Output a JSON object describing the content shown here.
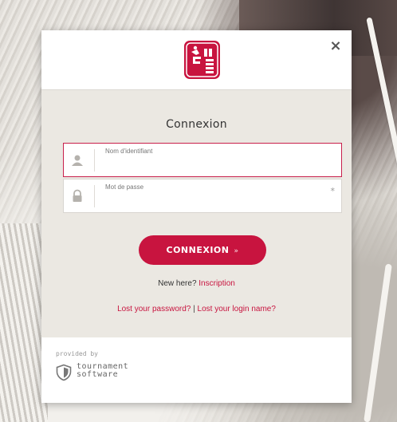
{
  "dialog": {
    "close_glyph": "×",
    "title": "Connexion"
  },
  "form": {
    "username_label": "Nom d'identifiant",
    "username_value": "",
    "password_label": "Mot de passe",
    "password_value": "",
    "required_mark": "*",
    "submit_label": "CONNEXION",
    "submit_arrow": "»"
  },
  "links": {
    "new_here_text": "New here?",
    "register_label": "Inscription",
    "lost_password_label": "Lost your password?",
    "separator": "|",
    "lost_login_label": "Lost your login name?"
  },
  "footer": {
    "provided_by": "provided by",
    "brand_line1": "tournament",
    "brand_line2": "software"
  },
  "colors": {
    "accent": "#c8143f",
    "panel_bg": "#ebe8e2"
  },
  "icons": {
    "logo": "ffbb-logo",
    "close": "close-icon",
    "user": "user-icon",
    "lock": "lock-icon",
    "shield": "shield-icon"
  }
}
